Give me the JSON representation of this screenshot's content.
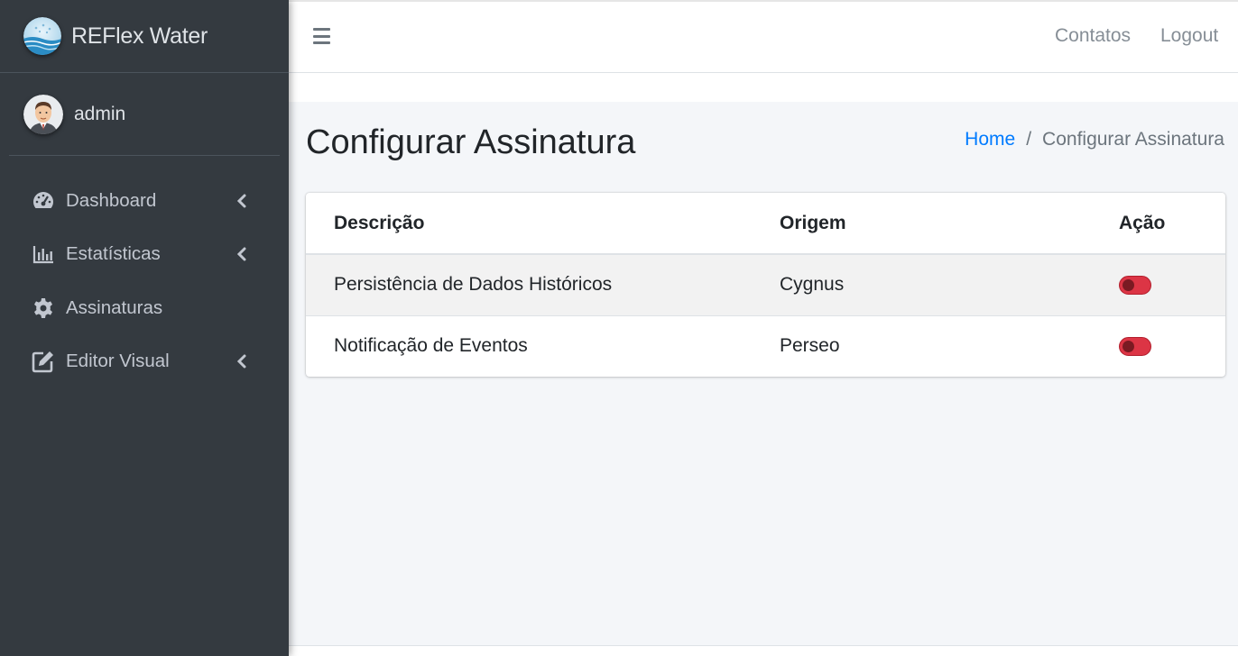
{
  "brand": {
    "name": "REFlex Water"
  },
  "user": {
    "name": "admin"
  },
  "sidebar": {
    "items": [
      {
        "label": "Dashboard",
        "icon": "tachometer-icon",
        "has_submenu": true
      },
      {
        "label": "Estatísticas",
        "icon": "bar-chart-icon",
        "has_submenu": true
      },
      {
        "label": "Assinaturas",
        "icon": "gear-icon",
        "has_submenu": false
      },
      {
        "label": "Editor Visual",
        "icon": "edit-icon",
        "has_submenu": true
      }
    ]
  },
  "topbar": {
    "menu_icon": "hamburger-icon",
    "links": [
      "Contatos",
      "Logout"
    ]
  },
  "page": {
    "title": "Configurar Assinatura",
    "breadcrumb": {
      "home": "Home",
      "separator": "/",
      "current": "Configurar Assinatura"
    }
  },
  "table": {
    "headers": [
      "Descrição",
      "Origem",
      "Ação"
    ],
    "rows": [
      {
        "descricao": "Persistência de Dados Históricos",
        "origem": "Cygnus",
        "acao_enabled": false
      },
      {
        "descricao": "Notificação de Eventos",
        "origem": "Perseo",
        "acao_enabled": false
      }
    ]
  },
  "colors": {
    "sidebar_bg": "#343a40",
    "accent_link": "#007bff",
    "toggle_off": "#dc3545"
  }
}
